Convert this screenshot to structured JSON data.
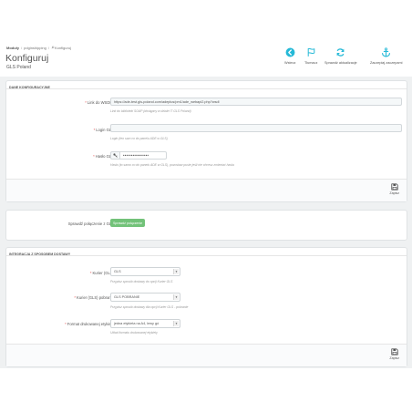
{
  "breadcrumb": {
    "items": [
      "Moduły",
      "pdginshipping",
      "Konfiguruj"
    ],
    "separator": "/"
  },
  "header": {
    "title": "Konfiguruj",
    "subtitle": "GLS Poland"
  },
  "toolbar": {
    "back_label": "Wstecz",
    "translate_label": "Tłumacz",
    "check_updates_label": "Sprawdź aktualizacje",
    "hooks_label": "Zaczepiaj zaczepami"
  },
  "config_panel": {
    "heading": "DANE KONFIGURACYJNE",
    "wsdl": {
      "label": "Link do WSDL2",
      "value": "https://ade-test.gls-poland.com/adeplus/pm1/ade_webapi2.php?wsdl",
      "help": "Link do biblioteki SOAP (dostępny w dziale IT GLS Poland)"
    },
    "login": {
      "label": "Login GLS",
      "value": "",
      "help": "Login (ten sam co do panelu ADE w GLS)"
    },
    "password": {
      "label": "Hasło GLS",
      "value": "••••••••••••••••",
      "help": "Hasło (to samo co do panelu ADE w GLS), pozostaw puste jeśli nie chcesz zmieniać hasła"
    },
    "save_label": "Zapisz"
  },
  "connection_panel": {
    "label": "Sprawdź połączenie z GLS",
    "button_label": "Sprawdź połączenie"
  },
  "integration_panel": {
    "heading": "INTEGRACJA Z SPOSOBEM DOSTAWY",
    "courier": {
      "label": "Kurier (GLS)",
      "selected": "GLS",
      "help": "Przypisz sposób dostawy do opcji Kurier GLS"
    },
    "courier_cod": {
      "label": "Kurier (GLS) pobranie",
      "selected": "GLS POBRANIE",
      "help": "Przypisz sposób dostawy dla opcji Kurier GLS - pobranie"
    },
    "label_format": {
      "label": "Format drukowanej etykiety",
      "selected": "jedna etykieta na A4, lewy gó",
      "help": "Układ formatu drukowanej etykiety"
    },
    "save_label": "Zapisz"
  },
  "colors": {
    "accent": "#25b9d7",
    "success": "#72c279",
    "required": "#e34b4b",
    "page_background": "#eff1f2"
  },
  "icons": [
    "back-icon",
    "flag-icon",
    "refresh-icon",
    "anchor-icon",
    "save-icon",
    "key-icon"
  ]
}
